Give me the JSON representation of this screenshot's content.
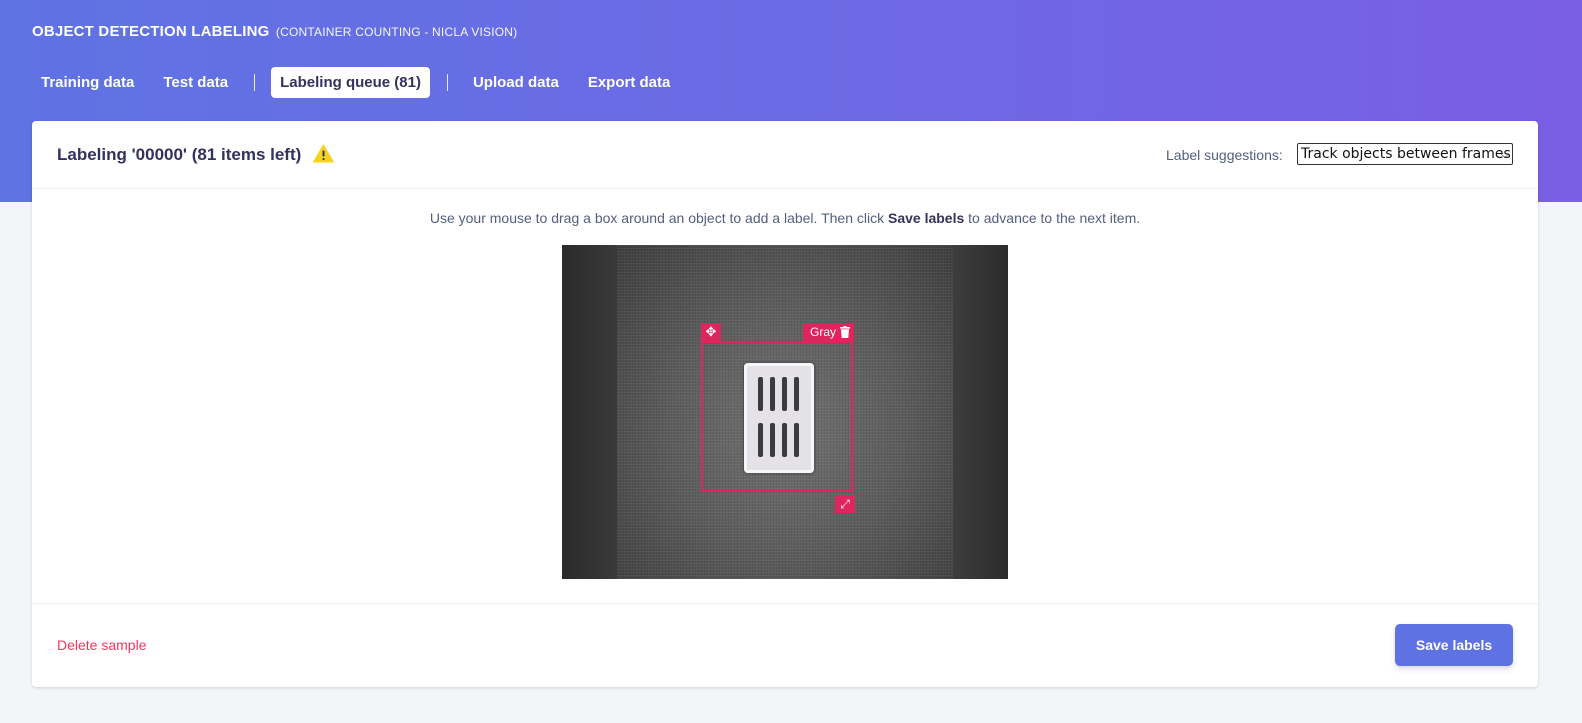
{
  "header": {
    "title": "OBJECT DETECTION LABELING",
    "subtitle": "(CONTAINER COUNTING - NICLA VISION)"
  },
  "nav": {
    "training": "Training data",
    "test": "Test data",
    "queue": "Labeling queue (81)",
    "upload": "Upload data",
    "export": "Export data",
    "active": "queue"
  },
  "card": {
    "title": "Labeling '00000' (81 items left)",
    "warning_icon": "warning-triangle-icon",
    "suggestions_label": "Label suggestions:",
    "suggestions_value": "Track objects between frames"
  },
  "instructions": {
    "before": "Use your mouse to drag a box around an object to add a label. Then click ",
    "bold": "Save labels",
    "after": " to advance to the next item."
  },
  "bounding_box": {
    "label": "Gray",
    "move_icon": "move-icon",
    "delete_icon": "trash-icon",
    "resize_icon": "resize-icon"
  },
  "footer": {
    "delete_label": "Delete sample",
    "save_label": "Save labels"
  },
  "colors": {
    "accent": "#5e72e4",
    "danger": "#f5365c",
    "bbox": "#e0245e",
    "warning": "#f6d31d"
  }
}
